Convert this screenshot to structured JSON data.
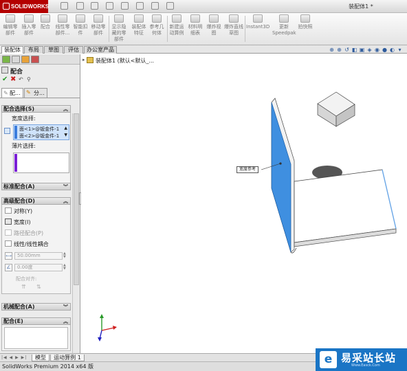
{
  "app": {
    "logo_text": "SOLIDWORKS",
    "document_title": "装配体1 *"
  },
  "ribbon": {
    "buttons": [
      {
        "label": "编辑零部件"
      },
      {
        "label": "插入零部件"
      },
      {
        "label": "配合"
      },
      {
        "label": "线性零部件..."
      },
      {
        "label": "智能扣件"
      },
      {
        "label": "移动零部件"
      },
      {
        "label": "显示隐藏的零部件"
      },
      {
        "label": "装配体特征"
      },
      {
        "label": "参考几何体"
      },
      {
        "label": "新建运动算例"
      },
      {
        "label": "材料明细表"
      },
      {
        "label": "爆炸视图"
      },
      {
        "label": "爆炸直线草图"
      },
      {
        "label": "Instant3D"
      },
      {
        "label": "更新Speedpak"
      },
      {
        "label": "拍快照"
      }
    ]
  },
  "command_tabs": [
    "装配体",
    "布局",
    "草图",
    "评估",
    "办公室产品"
  ],
  "feature_tree": {
    "root": "装配体1 (默认<默认_..."
  },
  "property_manager": {
    "title": "配合",
    "subtabs": [
      "配...",
      "分..."
    ],
    "mate_selection": {
      "title": "配合选择(S)",
      "width_label": "宽度选择:",
      "width_items": [
        "面<1>@钣金件-1",
        "面<2>@钣金件-1"
      ],
      "tab_label": "薄片选择:"
    },
    "standard_mates": "标准配合(A)",
    "advanced": {
      "title": "高级配合(D)",
      "options": [
        "对称(Y)",
        "宽度(I)",
        "路径配合(P)",
        "线性/线性耦合"
      ],
      "distance_value": "50.00mm",
      "angle_value": "0.00度",
      "alignment_label": "配合对齐:"
    },
    "mechanical_mates": "机械配合(A)",
    "mates": "配合(E)"
  },
  "viewport": {
    "callout_label": "宽度参考"
  },
  "bottom_tabs": [
    "模型",
    "运动算例 1"
  ],
  "status": {
    "text": "SolidWorks Premium 2014 x64 版"
  },
  "watermark": {
    "text": "易采站长站",
    "subtext": "Www.Easck.Com"
  },
  "colors": {
    "accent_blue": "#3f8fe0",
    "watermark_blue": "#1a75c5",
    "purple": "#7a1fd6",
    "brand_red": "#b40000"
  }
}
